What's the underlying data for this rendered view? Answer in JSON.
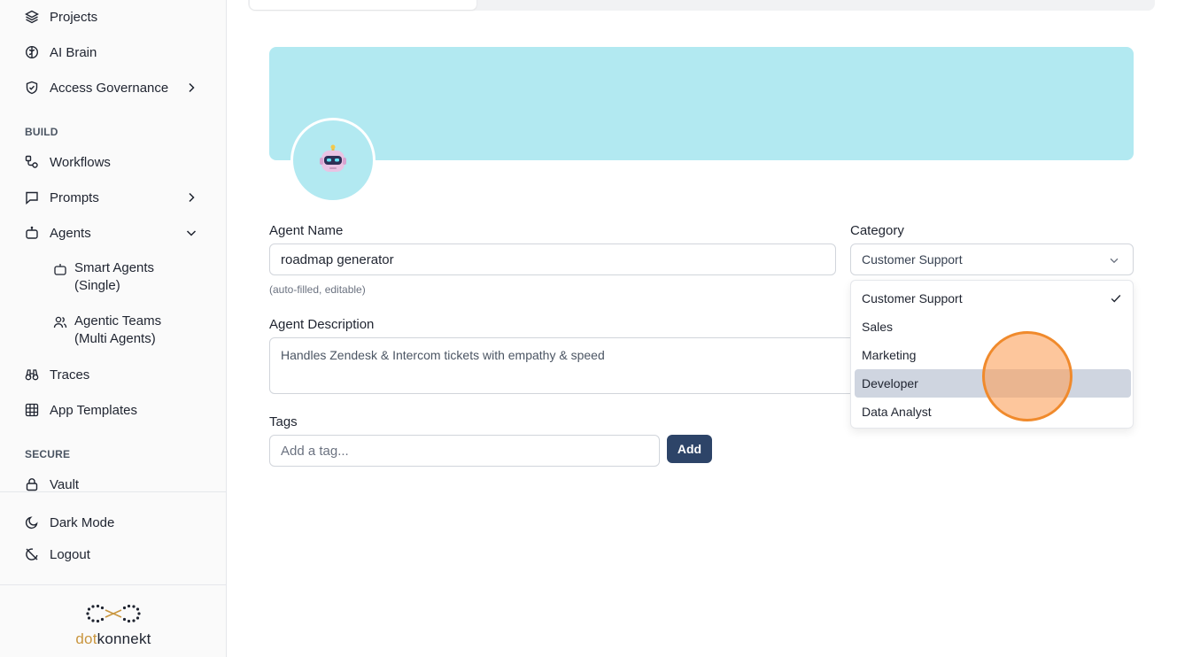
{
  "sidebar": {
    "items": {
      "projects": "Projects",
      "ai_brain": "AI Brain",
      "access_governance": "Access Governance",
      "workflows": "Workflows",
      "prompts": "Prompts",
      "agents": "Agents",
      "traces": "Traces",
      "app_templates": "App Templates",
      "vault": "Vault",
      "dark_mode": "Dark Mode",
      "logout": "Logout"
    },
    "sections": {
      "build": "BUILD",
      "secure": "SECURE"
    },
    "agent_subitems": {
      "smart_line1": "Smart Agents",
      "smart_line2": "(Single)",
      "teams_line1": "Agentic Teams",
      "teams_line2": "(Multi Agents)"
    },
    "brand": {
      "prefix": "dot",
      "suffix": "konnekt"
    }
  },
  "form": {
    "agent_name_label": "Agent Name",
    "agent_name_value": "roadmap generator",
    "agent_name_hint": "(auto-filled, editable)",
    "description_label": "Agent Description",
    "description_value": "Handles Zendesk & Intercom tickets with empathy & speed",
    "tags_label": "Tags",
    "tags_placeholder": "Add a tag...",
    "add_button": "Add",
    "category_label": "Category",
    "category_selected": "Customer Support",
    "category_options": [
      "Customer Support",
      "Sales",
      "Marketing",
      "Developer",
      "Data Analyst"
    ],
    "category_highlighted": "Developer"
  },
  "colors": {
    "banner": "#b2e9f1",
    "primary_button": "#2d4468",
    "cursor_highlight": "#f08a2c"
  },
  "icons": {
    "projects": "layers-icon",
    "ai_brain": "brain-icon",
    "access_governance": "shield-icon",
    "workflows": "workflow-icon",
    "prompts": "message-square-icon",
    "agents": "bot-icon",
    "traces": "binoculars-icon",
    "app_templates": "grid-icon",
    "vault": "lock-icon",
    "dark_mode": "moon-icon",
    "logout": "logout-icon"
  }
}
